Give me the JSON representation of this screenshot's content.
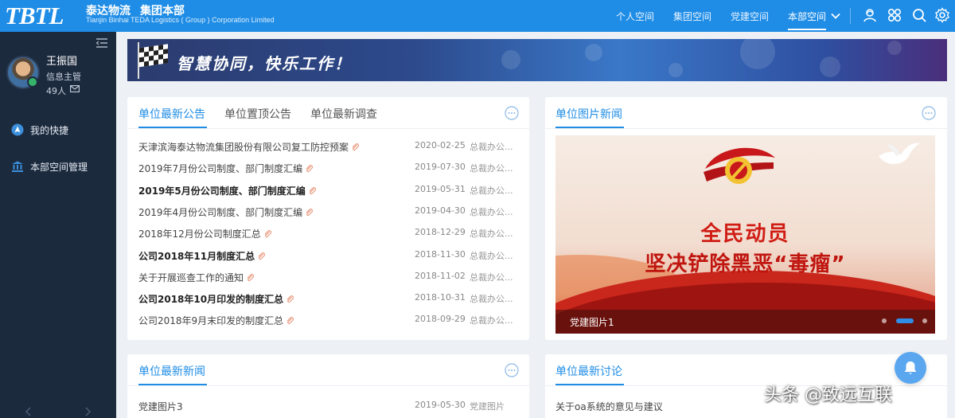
{
  "topbar": {
    "logo": "TBTL",
    "org_name_1": "泰达物流",
    "org_name_2": "集团本部",
    "org_sub": "Tianjin Binhai TEDA Logistics ( Group ) Corporation Limited",
    "nav": [
      "个人空间",
      "集团空间",
      "党建空间",
      "本部空间"
    ],
    "active_nav": "本部空间",
    "icons": [
      "chevron-down-icon",
      "user-center-icon",
      "apps-grid-icon",
      "search-icon",
      "settings-gear-icon"
    ]
  },
  "user": {
    "name": "王振国",
    "role": "信息主管",
    "count": "49人"
  },
  "sidebar": {
    "items": [
      {
        "label": "我的快捷",
        "icon": "navigation-icon"
      },
      {
        "label": "本部空间管理",
        "icon": "bank-icon"
      }
    ]
  },
  "banner": {
    "slogan": "智慧协同，快乐工作！"
  },
  "announcements": {
    "tabs": [
      "单位最新公告",
      "单位置顶公告",
      "单位最新调查"
    ],
    "rows": [
      {
        "title": "天津滨海泰达物流集团股份有限公司复工防控预案",
        "date": "2020-02-25",
        "dept": "总裁办公...",
        "bold": false
      },
      {
        "title": "2019年7月份公司制度、部门制度汇编",
        "date": "2019-07-30",
        "dept": "总裁办公...",
        "bold": false
      },
      {
        "title": " 2019年5月份公司制度、部门制度汇编",
        "date": "2019-05-31",
        "dept": "总裁办公...",
        "bold": true
      },
      {
        "title": " 2019年4月份公司制度、部门制度汇编",
        "date": "2019-04-30",
        "dept": "总裁办公...",
        "bold": false
      },
      {
        "title": "2018年12月份公司制度汇总",
        "date": "2018-12-29",
        "dept": "总裁办公...",
        "bold": false
      },
      {
        "title": "公司2018年11月制度汇总",
        "date": "2018-11-30",
        "dept": "总裁办公...",
        "bold": true
      },
      {
        "title": "关于开展巡查工作的通知",
        "date": "2018-11-02",
        "dept": "总裁办公...",
        "bold": false
      },
      {
        "title": "公司2018年10月印发的制度汇总",
        "date": "2018-10-31",
        "dept": "总裁办公...",
        "bold": true
      },
      {
        "title": "公司2018年9月末印发的制度汇总",
        "date": "2018-09-29",
        "dept": "总裁办公...",
        "bold": false
      }
    ]
  },
  "picture_news": {
    "tab": "单位图片新闻",
    "headline_1": "全民动员",
    "headline_2": "坚决铲除黑恶“毒瘤”",
    "caption": "党建图片1",
    "slide_count": 3,
    "active_slide": 2
  },
  "latest_news": {
    "tab": "单位最新新闻",
    "rows": [
      {
        "title": "党建图片3",
        "date": "2019-05-30",
        "dept": "党建图片"
      }
    ]
  },
  "discussions": {
    "tab": "单位最新讨论",
    "rows": [
      {
        "title": "关于oa系统的意见与建议"
      }
    ]
  },
  "watermark": "头条 @致远互联",
  "colors": {
    "accent": "#1f8de6",
    "sidebar": "#1c2a3e",
    "headline_red": "#d01e16"
  }
}
